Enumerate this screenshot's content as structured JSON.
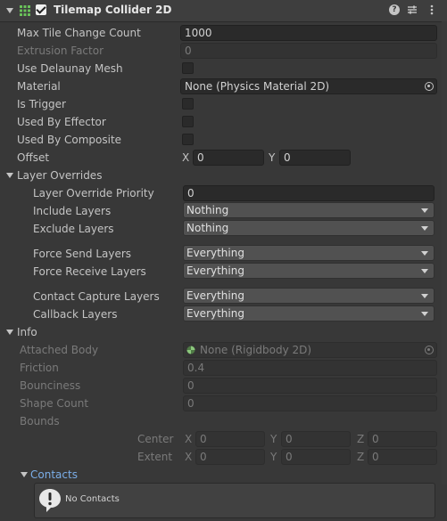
{
  "component": {
    "title": "Tilemap Collider 2D",
    "enabled": true
  },
  "props": {
    "max_tile_change_count": {
      "label": "Max Tile Change Count",
      "value": "1000"
    },
    "extrusion_factor": {
      "label": "Extrusion Factor",
      "value": "0"
    },
    "use_delaunay_mesh": {
      "label": "Use Delaunay Mesh",
      "checked": false
    },
    "material": {
      "label": "Material",
      "value": "None (Physics Material 2D)"
    },
    "is_trigger": {
      "label": "Is Trigger",
      "checked": false
    },
    "used_by_effector": {
      "label": "Used By Effector",
      "checked": false
    },
    "used_by_composite": {
      "label": "Used By Composite",
      "checked": false
    },
    "offset": {
      "label": "Offset",
      "x_label": "X",
      "x": "0",
      "y_label": "Y",
      "y": "0"
    }
  },
  "layer_overrides": {
    "label": "Layer Overrides",
    "priority": {
      "label": "Layer Override Priority",
      "value": "0"
    },
    "include_layers": {
      "label": "Include Layers",
      "value": "Nothing"
    },
    "exclude_layers": {
      "label": "Exclude Layers",
      "value": "Nothing"
    },
    "force_send_layers": {
      "label": "Force Send Layers",
      "value": "Everything"
    },
    "force_receive_layers": {
      "label": "Force Receive Layers",
      "value": "Everything"
    },
    "contact_capture_layers": {
      "label": "Contact Capture Layers",
      "value": "Everything"
    },
    "callback_layers": {
      "label": "Callback Layers",
      "value": "Everything"
    }
  },
  "info": {
    "label": "Info",
    "attached_body": {
      "label": "Attached Body",
      "value": "None (Rigidbody 2D)"
    },
    "friction": {
      "label": "Friction",
      "value": "0.4"
    },
    "bounciness": {
      "label": "Bounciness",
      "value": "0"
    },
    "shape_count": {
      "label": "Shape Count",
      "value": "0"
    },
    "bounds": {
      "label": "Bounds",
      "center": {
        "label": "Center",
        "x_label": "X",
        "x": "0",
        "y_label": "Y",
        "y": "0",
        "z_label": "Z",
        "z": "0"
      },
      "extent": {
        "label": "Extent",
        "x_label": "X",
        "x": "0",
        "y_label": "Y",
        "y": "0",
        "z_label": "Z",
        "z": "0"
      }
    },
    "contacts": {
      "label": "Contacts",
      "message": "No Contacts"
    }
  },
  "colors": {
    "background": "#383838",
    "field": "#2a2a2a",
    "dropdown": "#515151",
    "link": "#7baee8",
    "component_icon": "#6ac25a"
  },
  "icons": {
    "component": "tilemap-grid-icon",
    "help": "help-icon",
    "presets": "presets-icon",
    "menu": "kebab-menu-icon",
    "picker": "object-picker-icon",
    "warning": "info-exclamation-icon"
  }
}
